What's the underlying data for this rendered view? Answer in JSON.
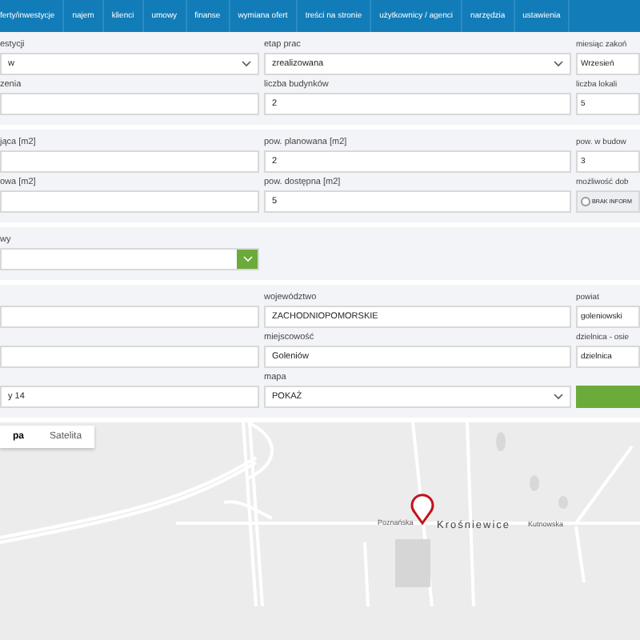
{
  "nav": [
    {
      "label": "ferty/inwestycje"
    },
    {
      "label": "najem"
    },
    {
      "label": "klienci"
    },
    {
      "label": "umowy"
    },
    {
      "label": "finanse"
    },
    {
      "label": "wymiana ofert"
    },
    {
      "label": "treści na stronie"
    },
    {
      "label": "użytkownicy / agenci"
    },
    {
      "label": "narzędzia"
    },
    {
      "label": "ustawienia"
    }
  ],
  "sections": [
    {
      "rows": [
        [
          {
            "kind": "select",
            "label": "estycji",
            "value": "w"
          },
          {
            "kind": "select",
            "label": "etap prac",
            "value": "zrealizowana"
          },
          {
            "kind": "input",
            "label": "miesiąc zakoń",
            "value": "Wrzesień"
          }
        ],
        [
          {
            "kind": "input",
            "label": "zenia"
          },
          {
            "kind": "input",
            "label": "liczba budynków",
            "value": "2"
          },
          {
            "kind": "input",
            "label": "liczba lokali",
            "value": "5"
          }
        ]
      ]
    },
    {
      "rows": [
        [
          {
            "kind": "input",
            "label": "jąca [m2]"
          },
          {
            "kind": "input",
            "label": "pow. planowana [m2]",
            "value": "2"
          },
          {
            "kind": "input",
            "label": "pow. w budow",
            "value": "3"
          }
        ],
        [
          {
            "kind": "input",
            "label": "owa [m2]"
          },
          {
            "kind": "input",
            "label": "pow. dostępna [m2]",
            "value": "5"
          },
          {
            "kind": "radio",
            "label": "możliwość dob",
            "value": "BRAK INFORM",
            "selected": false
          }
        ]
      ]
    },
    {
      "rows": [
        [
          {
            "kind": "select-button",
            "label": "wy"
          }
        ]
      ]
    },
    {
      "rows": [
        [
          {
            "kind": "input"
          },
          {
            "kind": "input",
            "label": "województwo",
            "value": "ZACHODNIOPOMORSKIE"
          },
          {
            "kind": "input",
            "label": "powiat",
            "value": "goleniowski"
          }
        ],
        [
          {
            "kind": "input"
          },
          {
            "kind": "input",
            "label": "miejscowość",
            "value": "Goleniów"
          },
          {
            "kind": "input",
            "label": "dzielnica - osie",
            "value": "dzielnica"
          }
        ],
        [
          {
            "kind": "input",
            "value": "y 14"
          },
          {
            "kind": "select",
            "label": "mapa",
            "value": "POKAŻ"
          },
          {
            "kind": "button"
          }
        ]
      ]
    }
  ],
  "map": {
    "types": [
      {
        "label": "pa",
        "selected": true
      },
      {
        "label": "Satelita",
        "selected": false
      }
    ],
    "labels": [
      {
        "kind": "street",
        "text": "Poznańska"
      },
      {
        "kind": "town",
        "text": "Krośniewice"
      },
      {
        "kind": "street",
        "text": "Kutnowska"
      }
    ]
  }
}
